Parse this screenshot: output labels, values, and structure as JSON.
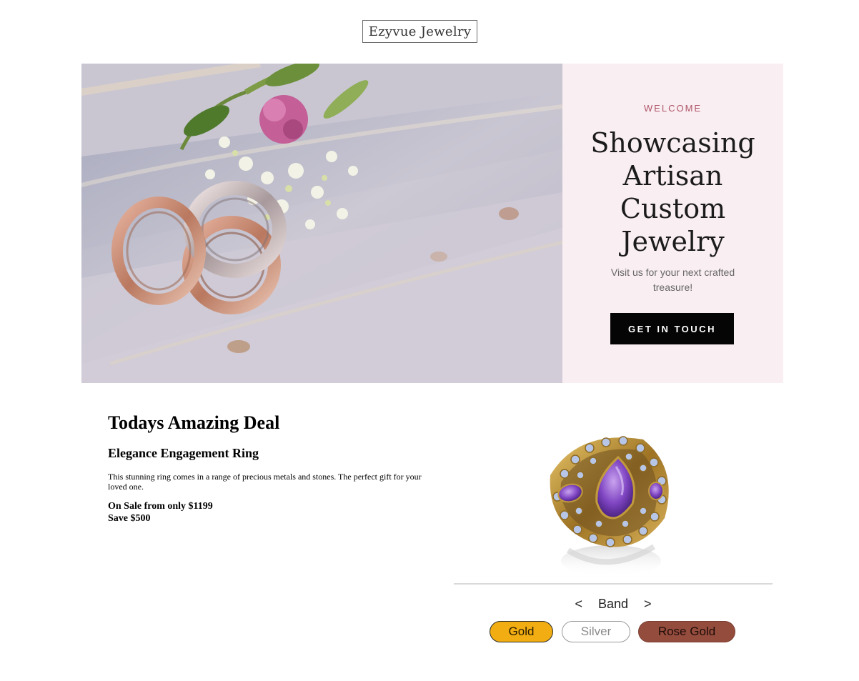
{
  "header": {
    "logo_text": "Ezyvue Jewelry"
  },
  "hero": {
    "image_icon": "wedding-rings-photo",
    "eyebrow": "WELCOME",
    "headline": "Showcasing Artisan Custom Jewelry",
    "subtext": "Visit us for your next crafted treasure!",
    "cta_label": "GET IN TOUCH",
    "panel_color": "#f9eef1",
    "eyebrow_color": "#b0566b"
  },
  "deal": {
    "heading": "Todays Amazing Deal",
    "product_name": "Elegance Engagement Ring",
    "description": "This stunning ring comes in a range of precious metals and stones. The perfect gift for your loved one.",
    "price_line": "On Sale from only $1199",
    "savings_line": "Save $500"
  },
  "product": {
    "image_icon": "amethyst-ring-photo",
    "selector": {
      "prev": "<",
      "label": "Band",
      "next": ">"
    },
    "options": [
      {
        "label": "Gold",
        "color": "#f1ad12"
      },
      {
        "label": "Silver",
        "color": "#ffffff"
      },
      {
        "label": "Rose Gold",
        "color": "#944c3d"
      }
    ]
  }
}
